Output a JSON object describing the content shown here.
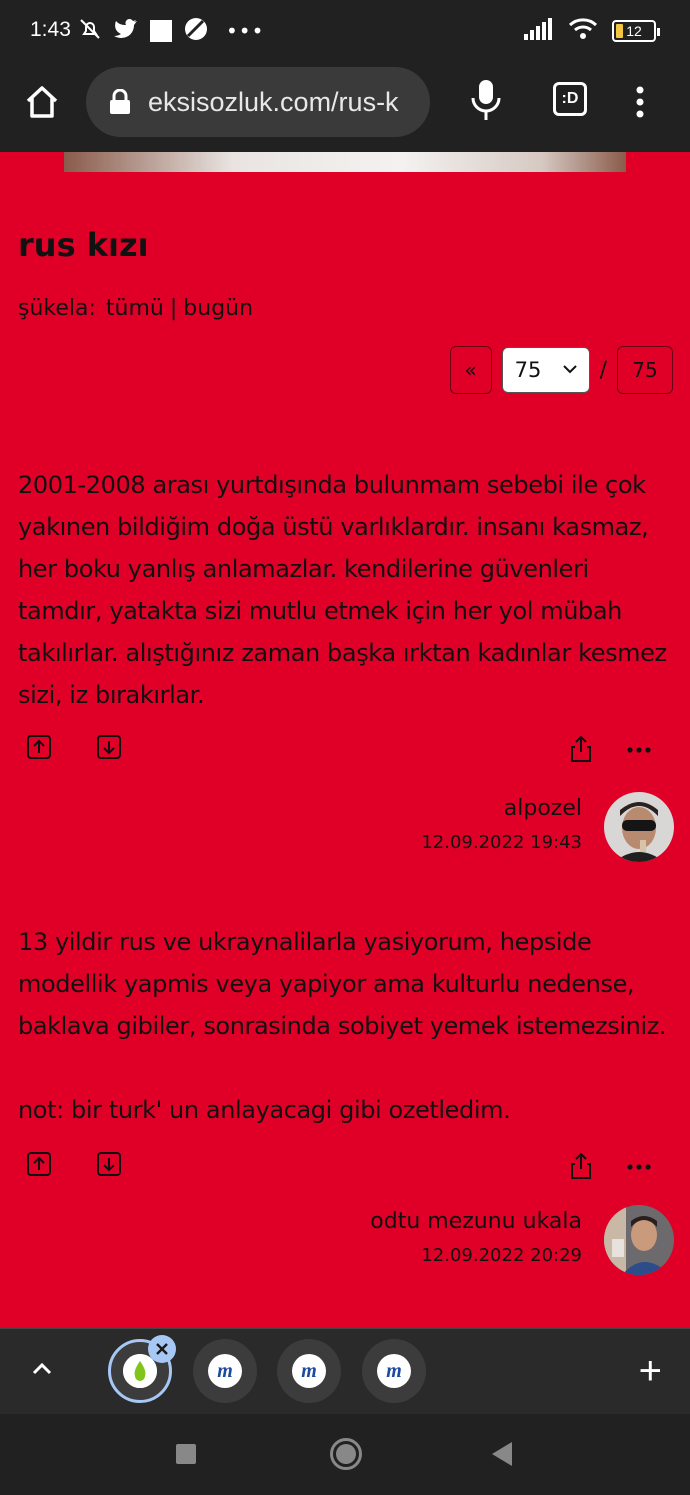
{
  "status_bar": {
    "time": "1:43",
    "battery": "12"
  },
  "browser": {
    "url": "eksisozluk.com/rus-k",
    "tab_button_label": ":D"
  },
  "topic": {
    "title": "rus kızı",
    "sukela_label": "şükela:",
    "sukela_all": "tümü",
    "sukela_separator": "|",
    "sukela_today": "bugün"
  },
  "pager": {
    "prev_label": "«",
    "current_page": "75",
    "separator": "/",
    "last_page": "75"
  },
  "entries": [
    {
      "text": "2001-2008 arası yurtdışında bulunmam sebebi ile çok yakınen bildiğim doğa üstü varlıklardır. insanı kasmaz, her boku yanlış anlamazlar. kendilerine güvenleri tamdır, yatakta sizi mutlu etmek için her yol mübah takılırlar. alıştığınız zaman başka ırktan kadınlar kesmez sizi, iz bırakırlar.",
      "author": "alpozel",
      "date": "12.09.2022 19:43"
    },
    {
      "text": "13 yildir rus ve ukraynalilarla yasiyorum, hepside modellik yapmis veya yapiyor ama kulturlu nedense, baklava gibiler, sonrasinda sobiyet yemek istemezsiniz.\n\nnot: bir turk' un anlayacagi gibi ozetledim.",
      "author": "odtu mezunu ukala",
      "date": "12.09.2022 20:29"
    }
  ],
  "colors": {
    "page_background": "#e00027",
    "chrome_background": "#212121",
    "accent_tab": "#a7c7f5"
  },
  "icons": {
    "home": "home-icon",
    "lock": "lock-icon",
    "mic": "mic-icon",
    "menu": "more-vertical-icon",
    "upvote": "arrow-up-box-icon",
    "downvote": "arrow-down-box-icon",
    "share": "share-icon",
    "more": "more-horizontal-icon"
  }
}
